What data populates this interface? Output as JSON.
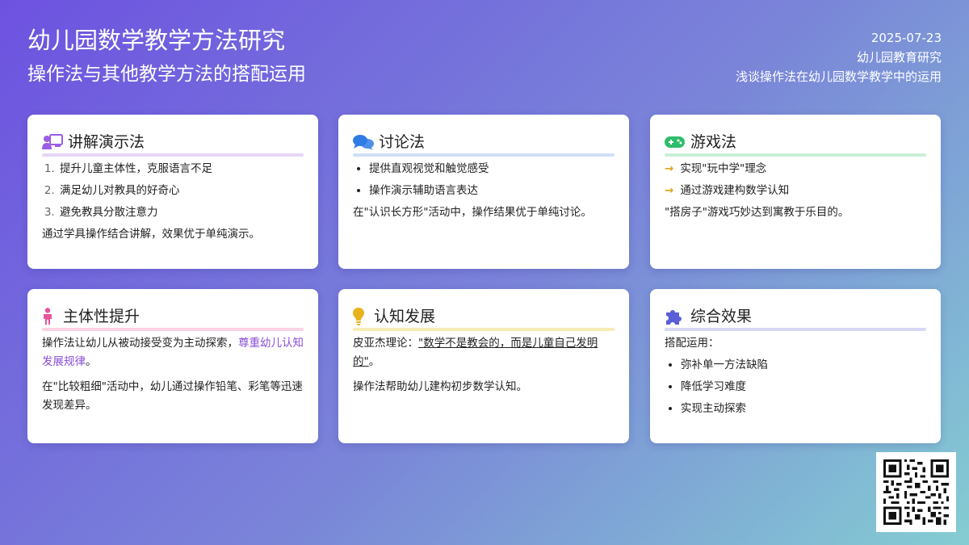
{
  "header": {
    "title": "幼儿园数学教学方法研究",
    "subtitle": "操作法与其他教学方法的搭配运用",
    "date": "2025-07-23",
    "org": "幼儿园教育研究",
    "topic": "浅谈操作法在幼儿园数学教学中的运用"
  },
  "cards": [
    {
      "title": "讲解演示法",
      "icon": "teacher-icon",
      "color": "#9b5de5",
      "underline": "#e6d6f7",
      "items": [
        "提升儿童主体性，克服语言不足",
        "满足幼儿对教具的好奇心",
        "避免教具分散注意力"
      ],
      "note": "通过学具操作结合讲解，效果优于单纯演示。"
    },
    {
      "title": "讨论法",
      "icon": "chat-icon",
      "color": "#2f7be5",
      "underline": "#cfe0f7",
      "items": [
        "提供直观视觉和触觉感受",
        "操作演示辅助语言表达"
      ],
      "note": "在\"认识长方形\"活动中，操作结果优于单纯讨论。"
    },
    {
      "title": "游戏法",
      "icon": "gamepad-icon",
      "color": "#2ebd6b",
      "underline": "#c9f0d6",
      "items": [
        "实现\"玩中学\"理念",
        "通过游戏建构数学认知"
      ],
      "note": "\"搭房子\"游戏巧妙达到寓教于乐目的。"
    },
    {
      "title": "主体性提升",
      "icon": "child-icon",
      "color": "#e5559a",
      "underline": "#f9d3e3",
      "text_before": "操作法让幼儿从被动接受变为主动探索，",
      "highlight": "尊重幼儿认知发展规律",
      "text_after": "。",
      "note": "在\"比较粗细\"活动中，幼儿通过操作铅笔、彩笔等迅速发现差异。"
    },
    {
      "title": "认知发展",
      "icon": "lightbulb-icon",
      "color": "#e8b21a",
      "underline": "#f7ecb5",
      "prefix": "皮亚杰理论：",
      "quote": "\"数学不是教会的，而是儿童自己发明的\"",
      "suffix": "。",
      "note": "操作法帮助幼儿建构初步数学认知。"
    },
    {
      "title": "综合效果",
      "icon": "puzzle-icon",
      "color": "#5a5fd6",
      "underline": "#d6d8f5",
      "intro": "搭配运用：",
      "items": [
        "弥补单一方法缺陷",
        "降低学习难度",
        "实现主动探索"
      ]
    }
  ]
}
